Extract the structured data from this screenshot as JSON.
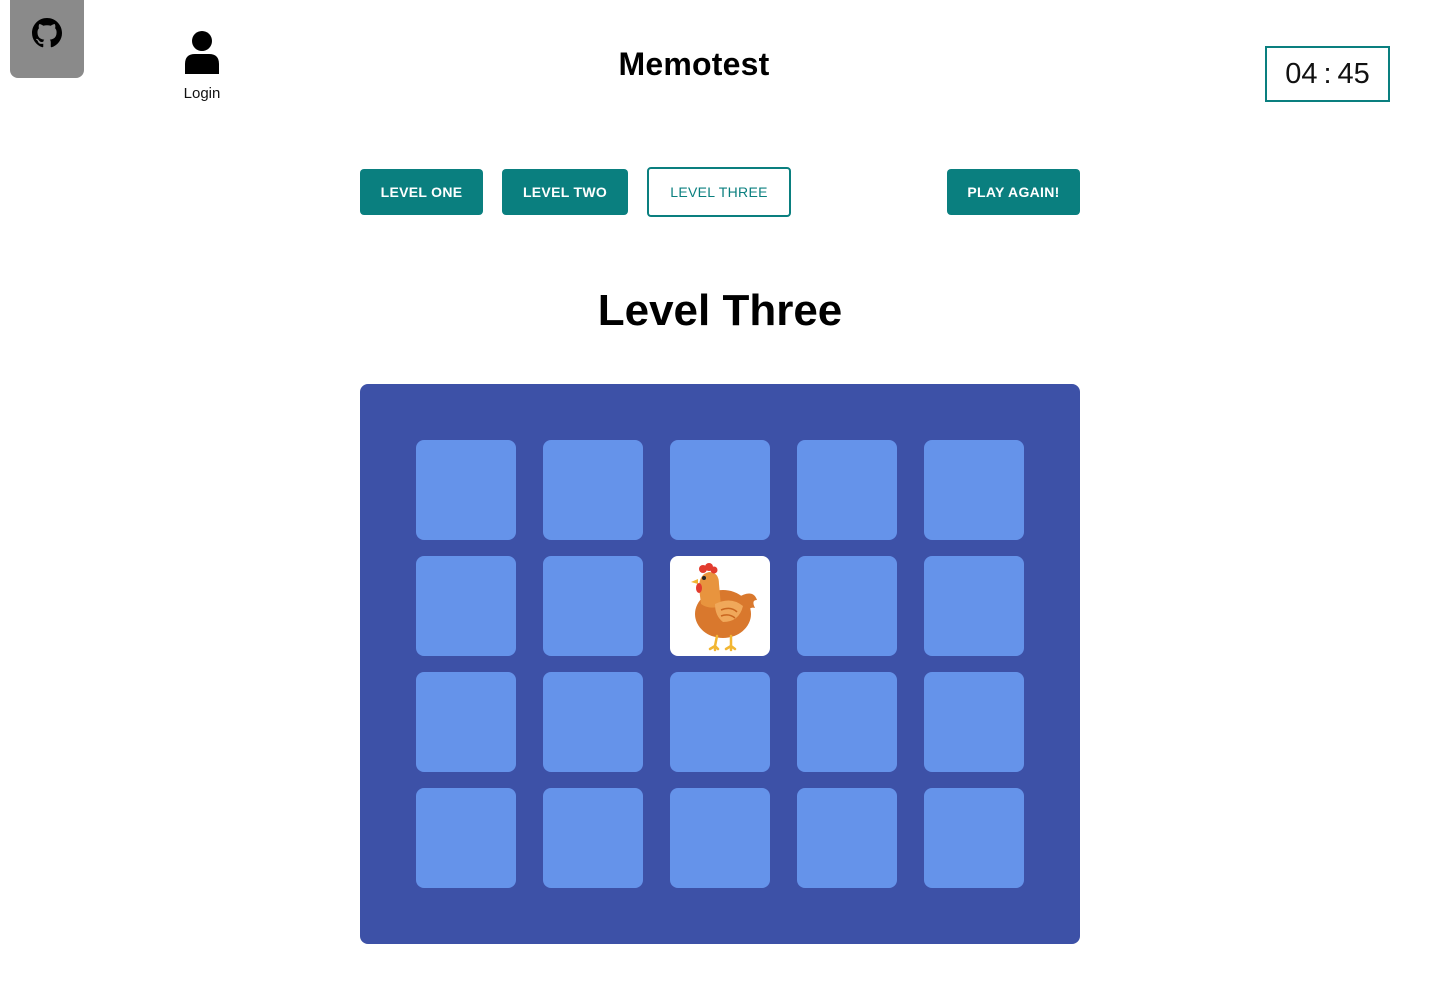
{
  "header": {
    "github_icon": "github-icon",
    "login_icon": "user-icon",
    "login_label": "Login",
    "title": "Memotest",
    "timer": {
      "minutes": "04",
      "separator": ":",
      "seconds": "45"
    }
  },
  "levels": {
    "level_one": "LEVEL ONE",
    "level_two": "LEVEL TWO",
    "level_three": "LEVEL THREE",
    "play_again": "PLAY AGAIN!",
    "active": "level_three"
  },
  "game": {
    "heading": "Level Three",
    "columns": 5,
    "rows": 4,
    "cards": [
      {
        "state": "hidden"
      },
      {
        "state": "hidden"
      },
      {
        "state": "hidden"
      },
      {
        "state": "hidden"
      },
      {
        "state": "hidden"
      },
      {
        "state": "hidden"
      },
      {
        "state": "hidden"
      },
      {
        "state": "revealed",
        "image": "chicken"
      },
      {
        "state": "hidden"
      },
      {
        "state": "hidden"
      },
      {
        "state": "hidden"
      },
      {
        "state": "hidden"
      },
      {
        "state": "hidden"
      },
      {
        "state": "hidden"
      },
      {
        "state": "hidden"
      },
      {
        "state": "hidden"
      },
      {
        "state": "hidden"
      },
      {
        "state": "hidden"
      },
      {
        "state": "hidden"
      },
      {
        "state": "hidden"
      }
    ]
  },
  "colors": {
    "accent": "#0a7f7f",
    "board": "#3d51a7",
    "card_back": "#6593ea",
    "card_face": "#ffffff",
    "github_tab": "#8a8a8a"
  }
}
